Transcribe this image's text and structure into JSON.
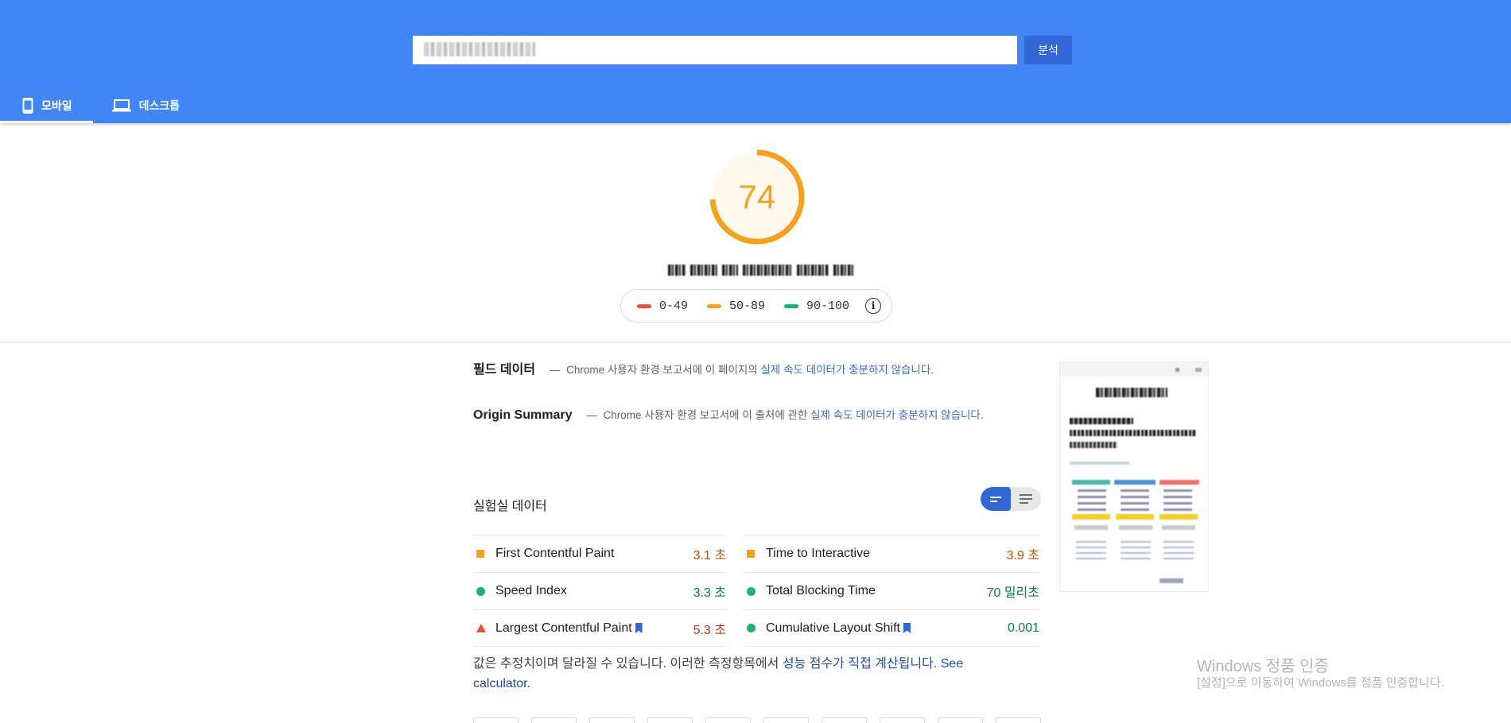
{
  "header": {
    "url_value": "",
    "analyze_label": "분석",
    "tabs": [
      {
        "label": "모바일",
        "icon": "mobile-icon",
        "active": true
      },
      {
        "label": "데스크톱",
        "icon": "desktop-icon",
        "active": false
      }
    ],
    "bg_color": "#4285f4"
  },
  "score": {
    "value": "74",
    "fraction": 0.74,
    "color": "#f2a21e"
  },
  "legend": {
    "items": [
      {
        "label": "0-49",
        "color": "#e8513d"
      },
      {
        "label": "50-89",
        "color": "#f2a21e"
      },
      {
        "label": "90-100",
        "color": "#1bb46a"
      }
    ]
  },
  "field_data": {
    "heading": "필드 데이터",
    "dash": "—",
    "source": "Chrome",
    "text": "사용자 환경 보고서에 이 페이지의",
    "link": "실제 속도 데이터가 충분하지 않습니다",
    "end": "."
  },
  "origin_summary": {
    "heading": "Origin Summary",
    "dash": "—",
    "source": "Chrome",
    "text": "사용자 환경 보고서에 이 출처에 관한",
    "link": "실제 속도 데이터가 충분하지 않습니다",
    "end": "."
  },
  "lab_data": {
    "heading": "실험실 데이터",
    "metrics_left": [
      {
        "name": "First Contentful Paint",
        "value": "3.1 초",
        "status": "average",
        "bookmark": false
      },
      {
        "name": "Speed Index",
        "value": "3.3 초",
        "status": "pass",
        "bookmark": false
      },
      {
        "name": "Largest Contentful Paint",
        "value": "5.3 초",
        "status": "fail",
        "bookmark": true
      }
    ],
    "metrics_right": [
      {
        "name": "Time to Interactive",
        "value": "3.9 초",
        "status": "average",
        "bookmark": false
      },
      {
        "name": "Total Blocking Time",
        "value": "70 밀리초",
        "status": "pass",
        "bookmark": false
      },
      {
        "name": "Cumulative Layout Shift",
        "value": "0.001",
        "status": "pass",
        "bookmark": true
      }
    ],
    "note_text": "값은 추정치이며 달라질 수 있습니다. 이러한 측정항목에서",
    "note_link1": "성능 점수가 직접 계산됩니다",
    "note_link2": "See calculator",
    "note_end": "."
  },
  "watermark": {
    "title": "Windows 정품 인증",
    "subtitle": "[설정]으로 이동하여 Windows를 정품 인증합니다."
  }
}
